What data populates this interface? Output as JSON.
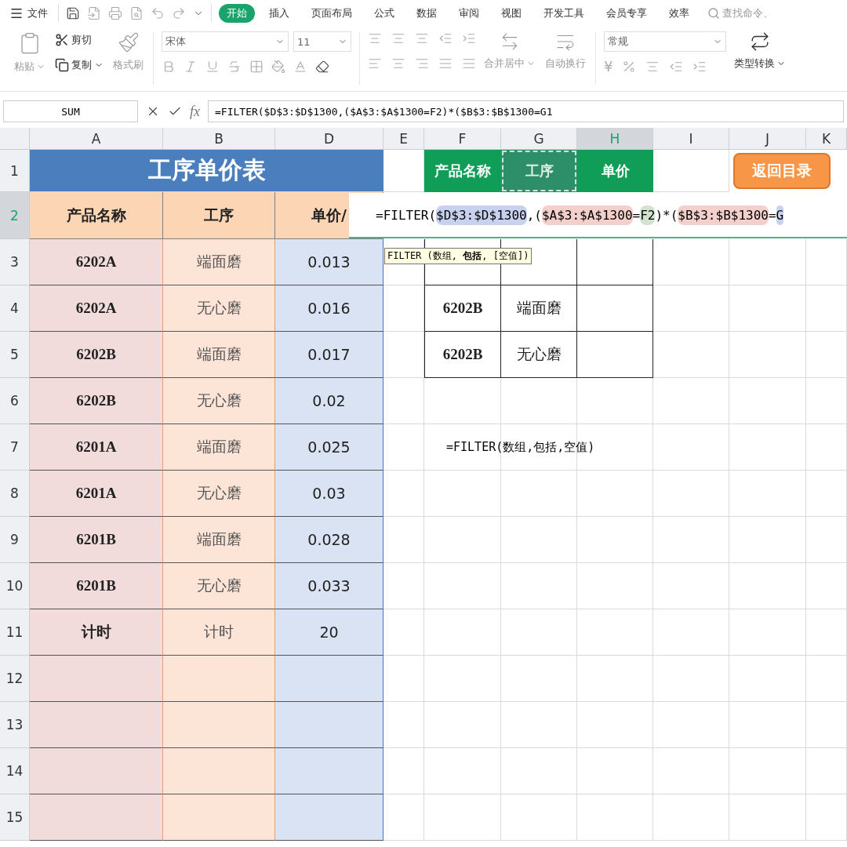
{
  "menu": {
    "label": "文件"
  },
  "tabs": [
    {
      "label": "开始",
      "selected": true
    },
    {
      "label": "插入",
      "selected": false
    },
    {
      "label": "页面布局",
      "selected": false
    },
    {
      "label": "公式",
      "selected": false
    },
    {
      "label": "数据",
      "selected": false
    },
    {
      "label": "审阅",
      "selected": false
    },
    {
      "label": "视图",
      "selected": false
    },
    {
      "label": "开发工具",
      "selected": false
    },
    {
      "label": "会员专享",
      "selected": false
    },
    {
      "label": "效率",
      "selected": false
    }
  ],
  "search": {
    "placeholder": "查找命令、"
  },
  "clipboard": {
    "paste": "粘贴",
    "cut": "剪切",
    "copy": "复制",
    "format_painter": "格式刷"
  },
  "font": {
    "name": "宋体",
    "size": "11"
  },
  "alignment": {
    "merge": "合并居中",
    "wrap": "自动换行"
  },
  "number": {
    "format": "常规",
    "currency": "¥",
    "convert": "类型转换"
  },
  "formula_bar": {
    "name_box": "SUM",
    "fx_label": "fx",
    "formula": "=FILTER($D$3:$D$1300,($A$3:$A$1300=F2)*($B$3:$B$1300=G1"
  },
  "sheet": {
    "columns": [
      {
        "label": "A",
        "selected": false
      },
      {
        "label": "B",
        "selected": false
      },
      {
        "label": "D",
        "selected": false
      },
      {
        "label": "E",
        "selected": false
      },
      {
        "label": "F",
        "selected": false
      },
      {
        "label": "G",
        "selected": false
      },
      {
        "label": "H",
        "selected": true
      },
      {
        "label": "I",
        "selected": false
      },
      {
        "label": "J",
        "selected": false
      },
      {
        "label": "K",
        "selected": false
      }
    ],
    "rows": [
      {
        "label": "1",
        "selected": false
      },
      {
        "label": "2",
        "selected": true
      },
      {
        "label": "3",
        "selected": false
      },
      {
        "label": "4",
        "selected": false
      },
      {
        "label": "5",
        "selected": false
      },
      {
        "label": "6",
        "selected": false
      },
      {
        "label": "7",
        "selected": false
      },
      {
        "label": "8",
        "selected": false
      },
      {
        "label": "9",
        "selected": false
      },
      {
        "label": "10",
        "selected": false
      },
      {
        "label": "11",
        "selected": false
      },
      {
        "label": "12",
        "selected": false
      },
      {
        "label": "13",
        "selected": false
      },
      {
        "label": "14",
        "selected": false
      },
      {
        "label": "15",
        "selected": false
      }
    ]
  },
  "price_table": {
    "title": "工序单价表",
    "headers": [
      "产品名称",
      "工序",
      "单价/"
    ],
    "rows": [
      [
        "6202A",
        "端面磨",
        "0.013"
      ],
      [
        "6202A",
        "无心磨",
        "0.016"
      ],
      [
        "6202B",
        "端面磨",
        "0.017"
      ],
      [
        "6202B",
        "无心磨",
        "0.02"
      ],
      [
        "6201A",
        "端面磨",
        "0.025"
      ],
      [
        "6201A",
        "无心磨",
        "0.03"
      ],
      [
        "6201B",
        "端面磨",
        "0.028"
      ],
      [
        "6201B",
        "无心磨",
        "0.033"
      ],
      [
        "计时",
        "计时",
        "20"
      ]
    ]
  },
  "lookup_table": {
    "headers": [
      {
        "label": "产品名称",
        "selected": false
      },
      {
        "label": "工序",
        "selected": true
      },
      {
        "label": "单价",
        "selected": false
      }
    ],
    "rows": [
      [],
      [
        "6202B",
        "端面磨"
      ],
      [
        "6202B",
        "无心磨"
      ]
    ]
  },
  "back_button": {
    "label": "返回目录"
  },
  "note": {
    "text": "=FILTER(数组,包括,空值)"
  },
  "cell_editor": {
    "segments": [
      {
        "text": "=FILTER("
      },
      {
        "text": "$D$3:$D$1300",
        "color": "#c8d2ee"
      },
      {
        "text": ",("
      },
      {
        "text": "$A$3:$A$1300",
        "color": "#f3d0cc"
      },
      {
        "text": "="
      },
      {
        "text": "F2",
        "color": "#d2e2cf"
      },
      {
        "text": ")*("
      },
      {
        "text": "$B$3:$B$1300",
        "color": "#f3d0cc"
      },
      {
        "text": "="
      },
      {
        "text": "G",
        "color": "#c8d2ee"
      }
    ]
  },
  "tooltip": {
    "text": "FILTER (数组, **包括**, [空值])"
  }
}
